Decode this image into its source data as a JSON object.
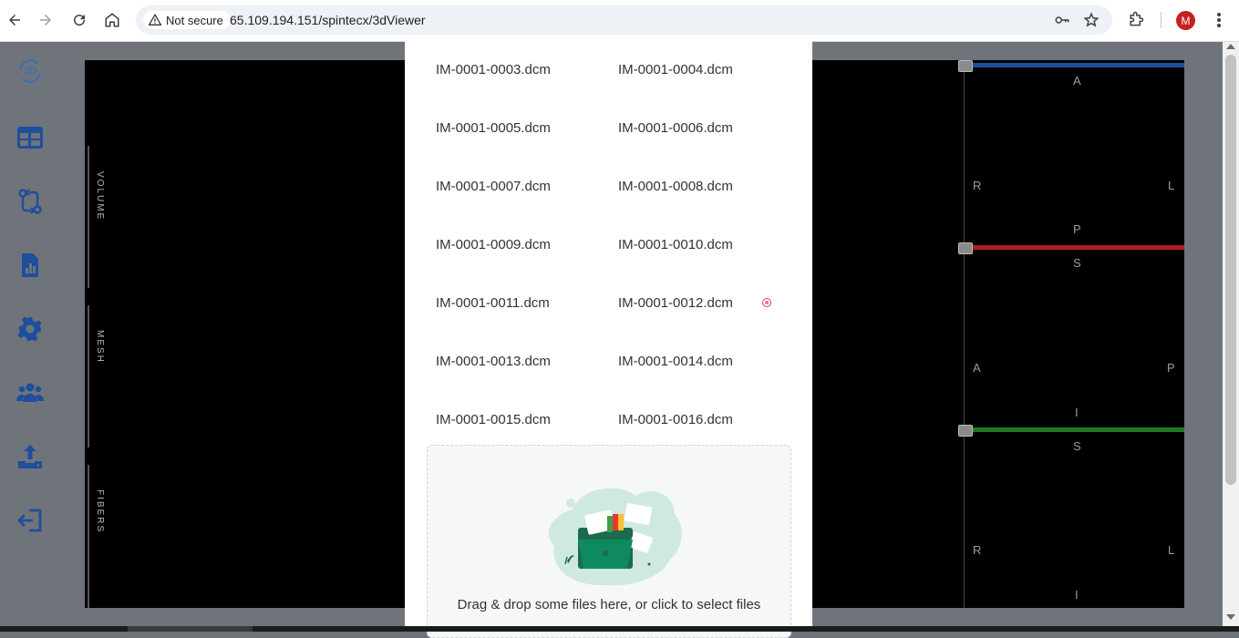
{
  "browser": {
    "security_label": "Not secure",
    "url": "65.109.194.151/spintecx/3dViewer",
    "avatar_letter": "M",
    "avatar_color": "#c5221f"
  },
  "sidebar": {
    "logo_text": "3D",
    "items": [
      {
        "name": "table-icon"
      },
      {
        "name": "compare-icon"
      },
      {
        "name": "report-icon"
      },
      {
        "name": "settings-icon"
      },
      {
        "name": "users-icon"
      },
      {
        "name": "upload-icon"
      },
      {
        "name": "logout-icon"
      }
    ],
    "accent_color": "#1f4e9c"
  },
  "viewer": {
    "tabs": [
      "VOLUME",
      "MESH",
      "FIBERS"
    ],
    "views": [
      {
        "top": "A",
        "left": "R",
        "right": "L",
        "bottom": "P",
        "bar_color": "#1d4e9c"
      },
      {
        "top": "S",
        "left": "A",
        "right": "P",
        "bottom": "I",
        "bar_color": "#b01e22"
      },
      {
        "top": "S",
        "left": "R",
        "right": "L",
        "bottom": "I",
        "bar_color": "#1f7a26"
      }
    ]
  },
  "files": {
    "rows": [
      [
        "IM-0001-0003.dcm",
        "IM-0001-0004.dcm"
      ],
      [
        "IM-0001-0005.dcm",
        "IM-0001-0006.dcm"
      ],
      [
        "IM-0001-0007.dcm",
        "IM-0001-0008.dcm"
      ],
      [
        "IM-0001-0009.dcm",
        "IM-0001-0010.dcm"
      ],
      [
        "IM-0001-0011.dcm",
        "IM-0001-0012.dcm"
      ],
      [
        "IM-0001-0013.dcm",
        "IM-0001-0014.dcm"
      ],
      [
        "IM-0001-0015.dcm",
        "IM-0001-0016.dcm"
      ]
    ]
  },
  "dropzone": {
    "text": "Drag & drop some files here, or click to select files"
  }
}
